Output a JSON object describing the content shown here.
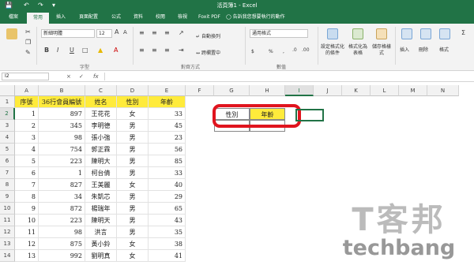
{
  "window": {
    "title": "活頁簿1 - Excel"
  },
  "tabs": [
    "檔案",
    "常用",
    "插入",
    "頁面配置",
    "公式",
    "資料",
    "校閱",
    "檢視",
    "Foxit PDF"
  ],
  "active_tab": "常用",
  "tell_me": "告訴我您想要執行的動作",
  "ribbon": {
    "font_name": "新細明體",
    "font_size": "12",
    "wrap_text": "自動換列",
    "merge_center": "跨欄置中",
    "number_format": "通用格式",
    "percent": "%",
    "comma": ",",
    "dollar": "$",
    "cond_format": "設定格式化的條件",
    "format_table": "格式化為表格",
    "cell_styles": "儲存格樣式",
    "insert": "插入",
    "delete": "刪除",
    "format": "格式",
    "group_font": "字型",
    "group_align": "對齊方式",
    "group_number": "數值"
  },
  "formula_bar": {
    "name_box": "I2",
    "fx": "fx",
    "cancel": "×",
    "enter": "✓"
  },
  "columns": [
    "A",
    "B",
    "C",
    "D",
    "E",
    "F",
    "G",
    "H",
    "I",
    "J",
    "K",
    "L",
    "M",
    "N"
  ],
  "selected_column": "I",
  "selected_row": "2",
  "rows": [
    "1",
    "2",
    "3",
    "4",
    "5",
    "6",
    "7",
    "8",
    "9",
    "10",
    "11",
    "12",
    "13",
    "14"
  ],
  "table": {
    "headers": [
      "序號",
      "36行會員編號",
      "姓名",
      "性別",
      "年齡"
    ],
    "data": [
      [
        "1",
        "897",
        "王花花",
        "女",
        "33"
      ],
      [
        "2",
        "345",
        "李明德",
        "男",
        "45"
      ],
      [
        "3",
        "98",
        "張小強",
        "男",
        "23"
      ],
      [
        "4",
        "754",
        "郭正霖",
        "男",
        "56"
      ],
      [
        "5",
        "223",
        "陳明大",
        "男",
        "85"
      ],
      [
        "6",
        "1",
        "柯台倩",
        "男",
        "33"
      ],
      [
        "7",
        "827",
        "王美麗",
        "女",
        "40"
      ],
      [
        "8",
        "34",
        "朱凱芯",
        "男",
        "29"
      ],
      [
        "9",
        "872",
        "楊瑞年",
        "男",
        "65"
      ],
      [
        "10",
        "223",
        "陳明天",
        "男",
        "43"
      ],
      [
        "11",
        "98",
        "洪言",
        "男",
        "35"
      ],
      [
        "12",
        "875",
        "黃小鈴",
        "女",
        "38"
      ],
      [
        "13",
        "992",
        "劉明真",
        "女",
        "41"
      ],
      [
        "14",
        "146",
        "許佐來",
        "男",
        "26"
      ]
    ]
  },
  "criteria": {
    "gender_label": "性別",
    "age_label": "年齡"
  },
  "watermark": {
    "chinese": "T客邦",
    "english": "techbang"
  },
  "colors": {
    "excel_green": "#217346",
    "header_yellow": "#ffeb3b",
    "highlight_red": "#e0141e"
  }
}
